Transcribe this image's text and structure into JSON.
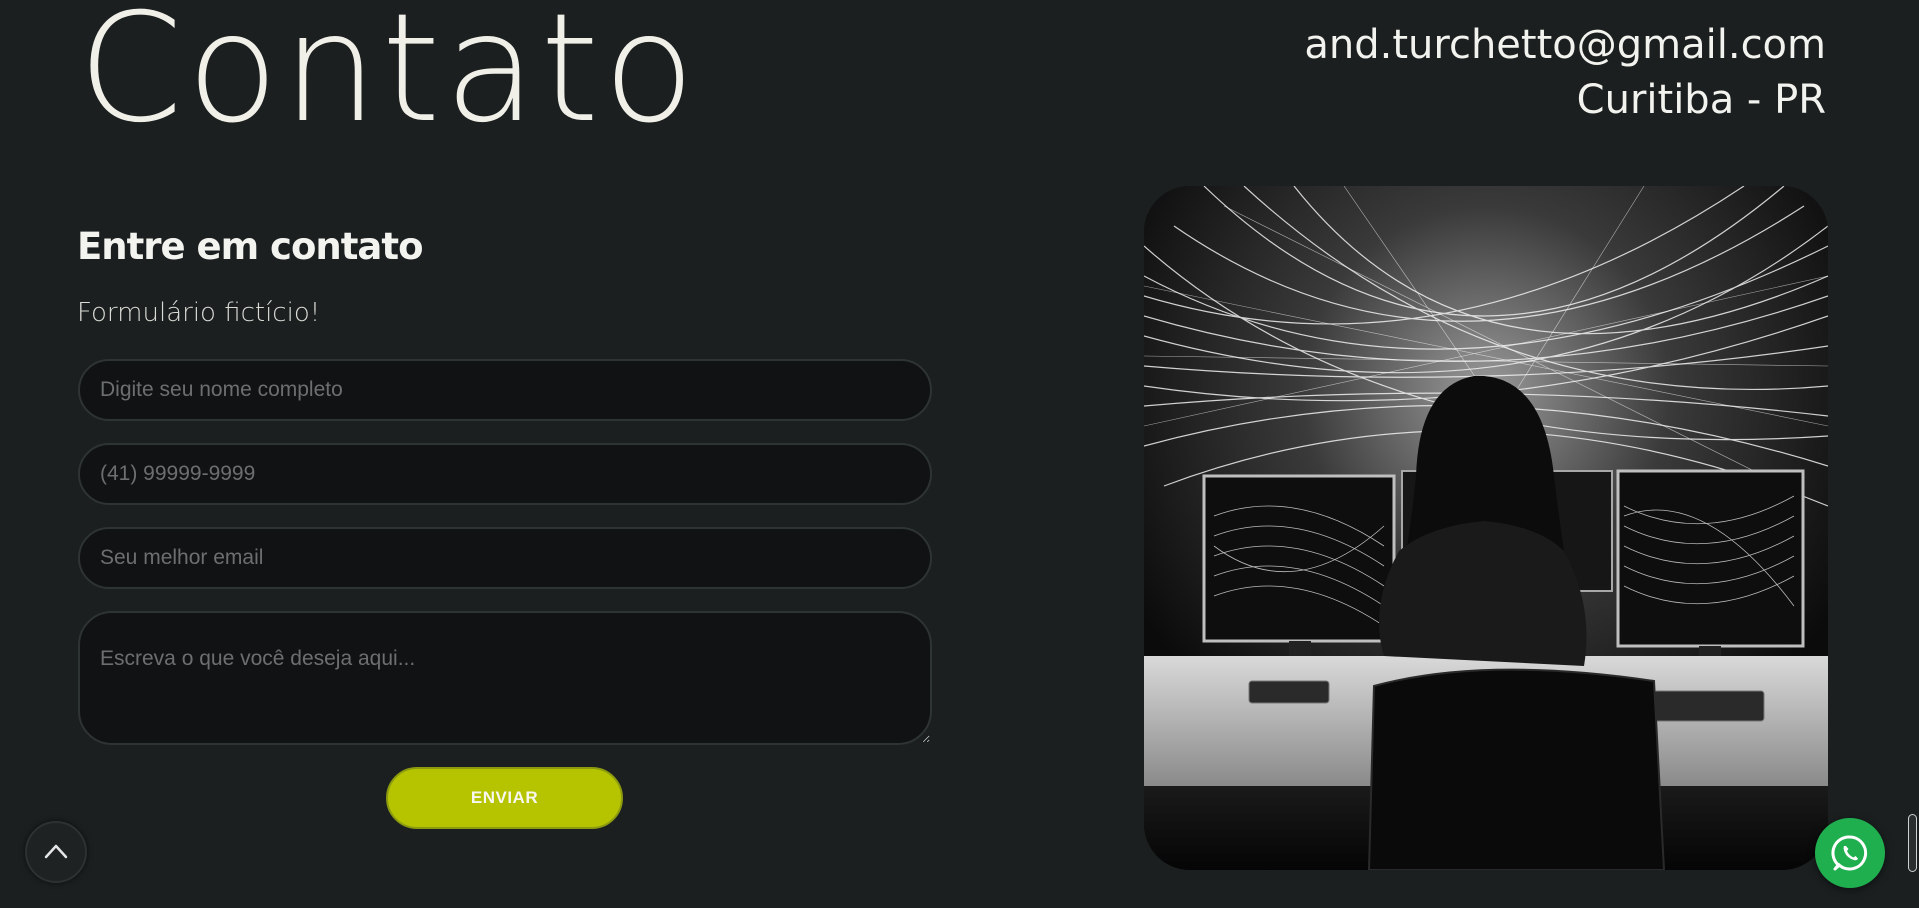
{
  "header": {
    "title": "Contato",
    "email": "and.turchetto@gmail.com",
    "city": "Curitiba - PR"
  },
  "form": {
    "heading": "Entre em contato",
    "subtitle": "Formulário fictício!",
    "name_placeholder": "Digite seu nome completo",
    "phone_placeholder": "(41) 99999-9999",
    "email_placeholder": "Seu melhor email",
    "message_placeholder": "Escreva o que você deseja aqui...",
    "submit_label": "ENVIAR"
  },
  "image": {
    "icon": "woman-at-monitors-illustration"
  },
  "floating": {
    "scroll_top_icon": "chevron-up-icon",
    "whatsapp_icon": "whatsapp-icon",
    "whatsapp_color": "#1faf4f"
  },
  "colors": {
    "background": "#1b1f20",
    "accent": "#b6c400",
    "field_background": "#111213"
  }
}
